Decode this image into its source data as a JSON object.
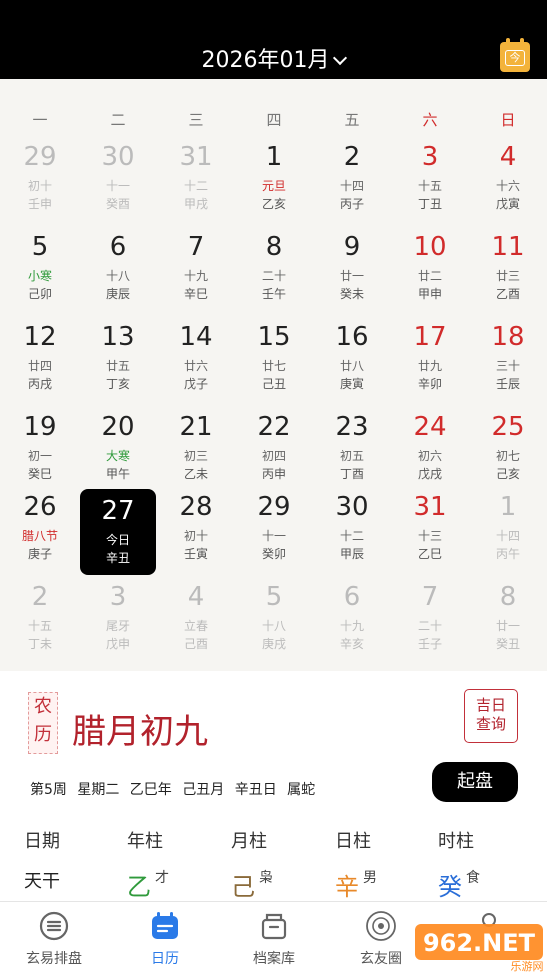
{
  "header": {
    "month_title": "2026年01月",
    "today_icon_label": "今"
  },
  "weekdays": [
    "一",
    "二",
    "三",
    "四",
    "五",
    "六",
    "日"
  ],
  "weeks": [
    [
      {
        "d": "29",
        "l": "初十",
        "g": "壬申",
        "o": true
      },
      {
        "d": "30",
        "l": "十一",
        "g": "癸酉",
        "o": true
      },
      {
        "d": "31",
        "l": "十二",
        "g": "甲戌",
        "o": true
      },
      {
        "d": "1",
        "l": "元旦",
        "g": "乙亥",
        "f": "red"
      },
      {
        "d": "2",
        "l": "十四",
        "g": "丙子"
      },
      {
        "d": "3",
        "l": "十五",
        "g": "丁丑"
      },
      {
        "d": "4",
        "l": "十六",
        "g": "戊寅"
      }
    ],
    [
      {
        "d": "5",
        "l": "小寒",
        "g": "己卯",
        "f": "green"
      },
      {
        "d": "6",
        "l": "十八",
        "g": "庚辰"
      },
      {
        "d": "7",
        "l": "十九",
        "g": "辛巳"
      },
      {
        "d": "8",
        "l": "二十",
        "g": "壬午"
      },
      {
        "d": "9",
        "l": "廿一",
        "g": "癸未"
      },
      {
        "d": "10",
        "l": "廿二",
        "g": "甲申"
      },
      {
        "d": "11",
        "l": "廿三",
        "g": "乙酉"
      }
    ],
    [
      {
        "d": "12",
        "l": "廿四",
        "g": "丙戌"
      },
      {
        "d": "13",
        "l": "廿五",
        "g": "丁亥"
      },
      {
        "d": "14",
        "l": "廿六",
        "g": "戊子"
      },
      {
        "d": "15",
        "l": "廿七",
        "g": "己丑"
      },
      {
        "d": "16",
        "l": "廿八",
        "g": "庚寅"
      },
      {
        "d": "17",
        "l": "廿九",
        "g": "辛卯"
      },
      {
        "d": "18",
        "l": "三十",
        "g": "壬辰"
      }
    ],
    [
      {
        "d": "19",
        "l": "初一",
        "g": "癸巳"
      },
      {
        "d": "20",
        "l": "大寒",
        "g": "甲午",
        "f": "green"
      },
      {
        "d": "21",
        "l": "初三",
        "g": "乙未"
      },
      {
        "d": "22",
        "l": "初四",
        "g": "丙申"
      },
      {
        "d": "23",
        "l": "初五",
        "g": "丁酉"
      },
      {
        "d": "24",
        "l": "初六",
        "g": "戊戌"
      },
      {
        "d": "25",
        "l": "初七",
        "g": "己亥"
      }
    ],
    [
      {
        "d": "26",
        "l": "腊八节",
        "g": "庚子",
        "f": "red"
      },
      {
        "d": "27",
        "l": "今日",
        "g": "辛丑",
        "sel": true
      },
      {
        "d": "28",
        "l": "初十",
        "g": "壬寅"
      },
      {
        "d": "29",
        "l": "十一",
        "g": "癸卯"
      },
      {
        "d": "30",
        "l": "十二",
        "g": "甲辰"
      },
      {
        "d": "31",
        "l": "十三",
        "g": "乙巳"
      },
      {
        "d": "1",
        "l": "十四",
        "g": "丙午",
        "o": true
      }
    ],
    [
      {
        "d": "2",
        "l": "十五",
        "g": "丁未",
        "o": true
      },
      {
        "d": "3",
        "l": "尾牙",
        "g": "戊申",
        "o": true
      },
      {
        "d": "4",
        "l": "立春",
        "g": "己酉",
        "o": true
      },
      {
        "d": "5",
        "l": "十八",
        "g": "庚戌",
        "o": true
      },
      {
        "d": "6",
        "l": "十九",
        "g": "辛亥",
        "o": true
      },
      {
        "d": "7",
        "l": "二十",
        "g": "壬子",
        "o": true
      },
      {
        "d": "8",
        "l": "廿一",
        "g": "癸丑",
        "o": true
      }
    ]
  ],
  "info": {
    "badge_top": "农",
    "badge_bottom": "历",
    "lunar_date": "腊月初九",
    "jiri_line1": "吉日",
    "jiri_line2": "查询",
    "detail": "第5周 星期二 乙巳年 己丑月 辛丑日 属蛇",
    "qipan_label": "起盘"
  },
  "pillars": {
    "headers": [
      "日期",
      "年柱",
      "月柱",
      "日柱",
      "时柱"
    ],
    "row_label": "天干",
    "stems": [
      {
        "char": "乙",
        "sup": "才",
        "color": "#2f9a3b"
      },
      {
        "char": "己",
        "sup": "枭",
        "color": "#8a6a3a"
      },
      {
        "char": "辛",
        "sup": "男",
        "color": "#e8892a"
      },
      {
        "char": "癸",
        "sup": "食",
        "color": "#2a6ed8"
      }
    ]
  },
  "tabs": [
    "玄易排盘",
    "日历",
    "档案库",
    "玄友圈"
  ],
  "watermark": {
    "brand": "962.NET",
    "sub": "乐游网"
  },
  "colors": {
    "accent": "#2a7ae8",
    "weekend_red": "#d12b2b",
    "lunar_red": "#b2222c",
    "solar_term_green": "#2f9a3b"
  }
}
